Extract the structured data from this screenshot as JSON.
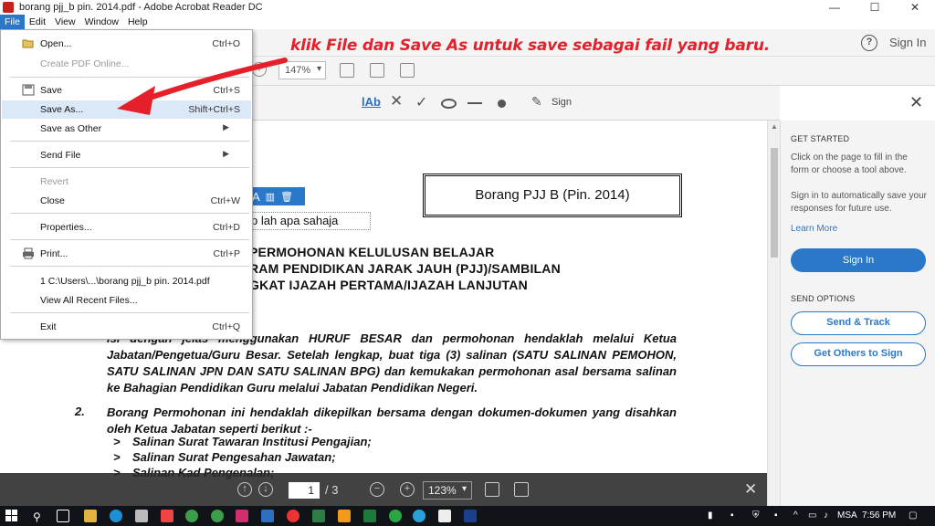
{
  "window": {
    "title": "borang pjj_b pin. 2014.pdf - Adobe Acrobat Reader DC",
    "minimize": "—",
    "maximize": "☐",
    "close": "✕"
  },
  "menubar": [
    "File",
    "Edit",
    "View",
    "Window",
    "Help"
  ],
  "toolbar": {
    "help": "?",
    "sign_in": "Sign In",
    "zoom": "147%"
  },
  "fill_sign": {
    "text_tool": "lAb",
    "cross": "✕",
    "check": "✓",
    "sign_label": "Sign",
    "close": "✕"
  },
  "file_menu": {
    "items": [
      {
        "label": "Open...",
        "shortcut": "Ctrl+O",
        "enabled": true
      },
      {
        "label": "Create PDF Online...",
        "shortcut": "",
        "enabled": false
      },
      {
        "label": "Save",
        "shortcut": "Ctrl+S",
        "enabled": true
      },
      {
        "label": "Save As...",
        "shortcut": "Shift+Ctrl+S",
        "enabled": true
      },
      {
        "label": "Save as Other",
        "shortcut": "",
        "enabled": true
      },
      {
        "label": "Send File",
        "shortcut": "",
        "enabled": true
      },
      {
        "label": "Revert",
        "shortcut": "",
        "enabled": false
      },
      {
        "label": "Close",
        "shortcut": "Ctrl+W",
        "enabled": true
      },
      {
        "label": "Properties...",
        "shortcut": "Ctrl+D",
        "enabled": true
      },
      {
        "label": "Print...",
        "shortcut": "Ctrl+P",
        "enabled": true
      },
      {
        "label": "1 C:\\Users\\...\\borang pjj_b pin. 2014.pdf",
        "shortcut": "",
        "enabled": true
      },
      {
        "label": "View All Recent Files...",
        "shortcut": "",
        "enabled": true
      },
      {
        "label": "Exit",
        "shortcut": "Ctrl+Q",
        "enabled": true
      }
    ]
  },
  "annotation": "klik File dan Save As untuk save sebagai fail yang baru.",
  "document": {
    "form_code": "Borang PJJ B (Pin. 2014)",
    "field_value": "p lah apa sahaja",
    "heading_1": "PERMOHONAN KELULUSAN BELAJAR",
    "heading_2": "RAM PENDIDIKAN JARAK JAUH (PJJ)/SAMBILAN",
    "heading_3": "GKAT IJAZAH PERTAMA/IJAZAH LANJUTAN",
    "para_1": "isi dengan jelas menggunakan HURUF BESAR dan permohonan hendaklah melalui Ketua Jabatan/Pengetua/Guru Besar. Setelah lengkap, buat tiga (3) salinan (SATU SALINAN PEMOHON, SATU SALINAN JPN DAN SATU SALINAN BPG) dan kemukakan permohonan asal bersama salinan ke Bahagian Pendidikan Guru melalui Jabatan Pendidikan Negeri.",
    "item_2_num": "2.",
    "item_2_text": "Borang Permohonan ini hendaklah dikepilkan bersama dengan dokumen-dokumen yang disahkan oleh Ketua Jabatan seperti berikut :-",
    "bullets": [
      "Salinan Surat Tawaran Institusi Pengajian;",
      "Salinan Surat Pengesahan Jawatan;",
      "Salinan Kad Pengenalan;"
    ],
    "bullet_marker": ">"
  },
  "page_nav": {
    "current_page": "1",
    "total_pages": "/ 3",
    "zoom": "123%"
  },
  "right_pane": {
    "get_started": "GET STARTED",
    "get_started_text": "Click on the page to fill in the form or choose a tool above.",
    "sign_in_text": "Sign in to automatically save your responses for future use.",
    "learn_more": "Learn More",
    "sign_in_button": "Sign In",
    "send_options": "SEND OPTIONS",
    "send_track": "Send & Track",
    "get_others": "Get Others to Sign"
  },
  "taskbar": {
    "language": "MSA",
    "time": "7:56 PM"
  },
  "colors": {
    "accent": "#2b78c8",
    "annotation": "#e5202a"
  }
}
